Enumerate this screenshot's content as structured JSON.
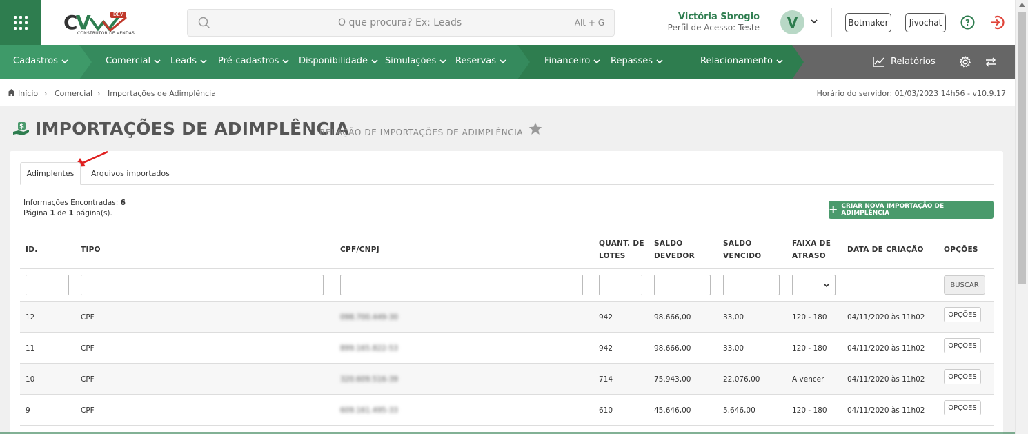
{
  "header": {
    "logo_sub": "CONSTRUTOR DE VENDAS",
    "logo_badge": "DEV",
    "search_placeholder": "O que procura? Ex: Leads",
    "search_hint": "Alt + G",
    "user_name": "Victória Sbrogio",
    "user_profile": "Perfil de Acesso: Teste",
    "avatar_initial": "V",
    "botmaker_label": "Botmaker",
    "jivochat_label": "Jivochat"
  },
  "nav": {
    "cadastros": "Cadastros",
    "comercial": "Comercial",
    "leads": "Leads",
    "pre_cadastros": "Pré-cadastros",
    "disponibilidade": "Disponibilidade",
    "simulacoes": "Simulações",
    "reservas": "Reservas",
    "financeiro": "Financeiro",
    "repasses": "Repasses",
    "relacionamento": "Relacionamento",
    "relatorios": "Relatórios",
    "colors": {
      "seg1": "#3e9a69",
      "seg2": "#358a5d",
      "seg3": "#2e7d4f",
      "gray": "#666666"
    }
  },
  "breadcrumb": {
    "home": "Início",
    "comercial": "Comercial",
    "current": "Importações de Adimplência",
    "server_time": "Horário do servidor: 01/03/2023 14h56 - v10.9.17"
  },
  "page": {
    "title": "IMPORTAÇÕES DE ADIMPLÊNCIA",
    "subtitle": "RELAÇÃO DE IMPORTAÇÕES DE ADIMPLÊNCIA"
  },
  "tabs": {
    "active": "Adimplentes",
    "other": "Arquivos importados"
  },
  "info": {
    "found_label": "Informações Encontradas:",
    "found_count": "6",
    "page_prefix": "Página",
    "page_num": "1",
    "page_of": "de",
    "page_total": "1",
    "page_suffix": "página(s)."
  },
  "create_button": "CRIAR NOVA IMPORTAÇÃO DE ADIMPLÊNCIA",
  "table": {
    "headers": {
      "id": "ID.",
      "tipo": "TIPO",
      "cpf": "CPF/CNPJ",
      "lotes_1": "QUANT. DE",
      "lotes_2": "LOTES",
      "devedor_1": "SALDO",
      "devedor_2": "DEVEDOR",
      "vencido_1": "SALDO",
      "vencido_2": "VENCIDO",
      "faixa_1": "FAIXA DE",
      "faixa_2": "ATRASO",
      "data": "DATA DE CRIAÇÃO",
      "opcoes": "OPÇÕES"
    },
    "search_button": "BUSCAR",
    "rows": [
      {
        "id": "12",
        "tipo": "CPF",
        "cpf": "098.700.449-30",
        "lotes": "942",
        "devedor": "98.666,00",
        "vencido": "33,00",
        "faixa": "120 - 180",
        "data": "04/11/2020 às 11h02",
        "opcoes": "OPÇÕES"
      },
      {
        "id": "11",
        "tipo": "CPF",
        "cpf": "899.165.822-53",
        "lotes": "942",
        "devedor": "98.666,00",
        "vencido": "33,00",
        "faixa": "120 - 180",
        "data": "04/11/2020 às 11h02",
        "opcoes": "OPÇÕES"
      },
      {
        "id": "10",
        "tipo": "CPF",
        "cpf": "320.609.516-39",
        "lotes": "714",
        "devedor": "75.943,00",
        "vencido": "22.076,00",
        "faixa": "A vencer",
        "data": "04/11/2020 às 11h02",
        "opcoes": "OPÇÕES"
      },
      {
        "id": "9",
        "tipo": "CPF",
        "cpf": "609.161.495-33",
        "lotes": "610",
        "devedor": "45.646,00",
        "vencido": "5.646,00",
        "faixa": "120 - 180",
        "data": "04/11/2020 às 11h02",
        "opcoes": "OPÇÕES"
      }
    ]
  }
}
